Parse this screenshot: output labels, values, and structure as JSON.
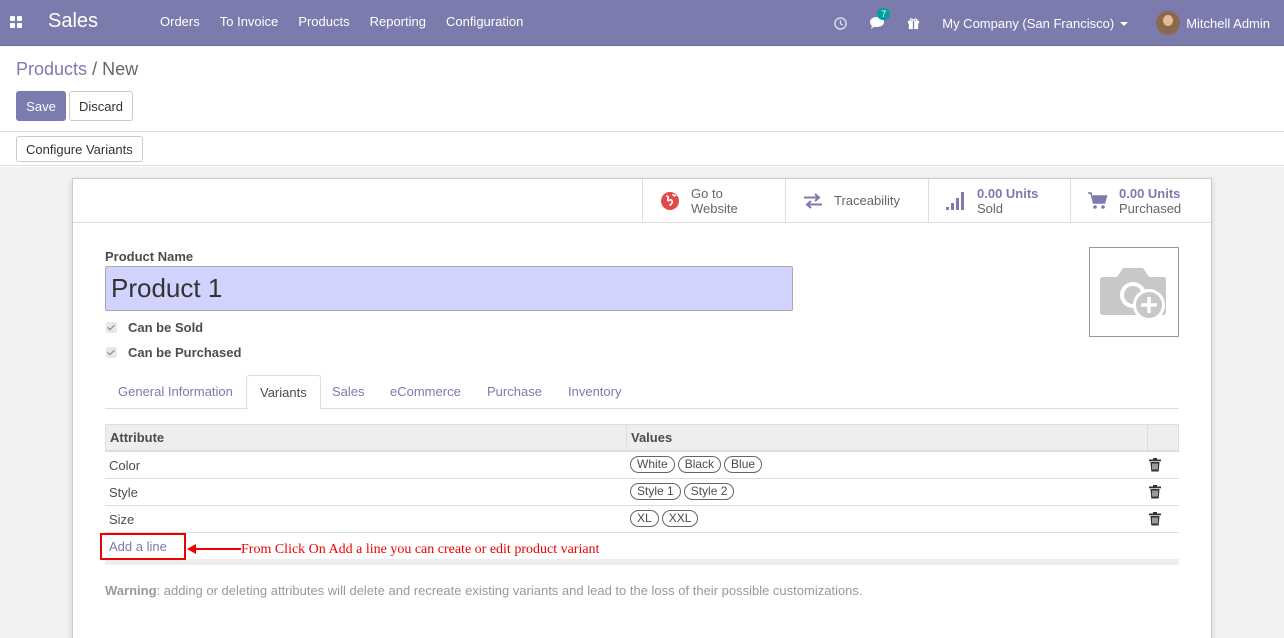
{
  "navbar": {
    "app_name": "Sales",
    "menu": [
      "Orders",
      "To Invoice",
      "Products",
      "Reporting",
      "Configuration"
    ],
    "messages_badge": "7",
    "company": "My Company (San Francisco)",
    "user": "Mitchell Admin",
    "bg_color": "#7c7bad"
  },
  "breadcrumb": {
    "parent": "Products",
    "separator": "/",
    "current": "New"
  },
  "buttons": {
    "save": "Save",
    "discard": "Discard",
    "configure_variants": "Configure Variants"
  },
  "smart_buttons": {
    "website_line1": "Go to",
    "website_line2": "Website",
    "traceability": "Traceability",
    "sold_value": "0.00 Units",
    "sold_label": "Sold",
    "purchased_value": "0.00 Units",
    "purchased_label": "Purchased"
  },
  "form": {
    "product_name_label": "Product Name",
    "product_name": "Product 1",
    "can_be_sold": "Can be Sold",
    "can_be_purchased": "Can be Purchased"
  },
  "tabs": [
    "General Information",
    "Variants",
    "Sales",
    "eCommerce",
    "Purchase",
    "Inventory"
  ],
  "active_tab": "Variants",
  "table": {
    "headers": [
      "Attribute",
      "Values"
    ],
    "rows": [
      {
        "attribute": "Color",
        "values": [
          "White",
          "Black",
          "Blue"
        ]
      },
      {
        "attribute": "Style",
        "values": [
          "Style 1",
          "Style 2"
        ]
      },
      {
        "attribute": "Size",
        "values": [
          "XL",
          "XXL"
        ]
      }
    ],
    "add_line": "Add a line"
  },
  "annotation": "From Click On Add a line you can create or edit product variant",
  "warning": {
    "title": "Warning",
    "text": ": adding or deleting attributes will delete and recreate existing variants and lead to the loss of their possible customizations."
  }
}
